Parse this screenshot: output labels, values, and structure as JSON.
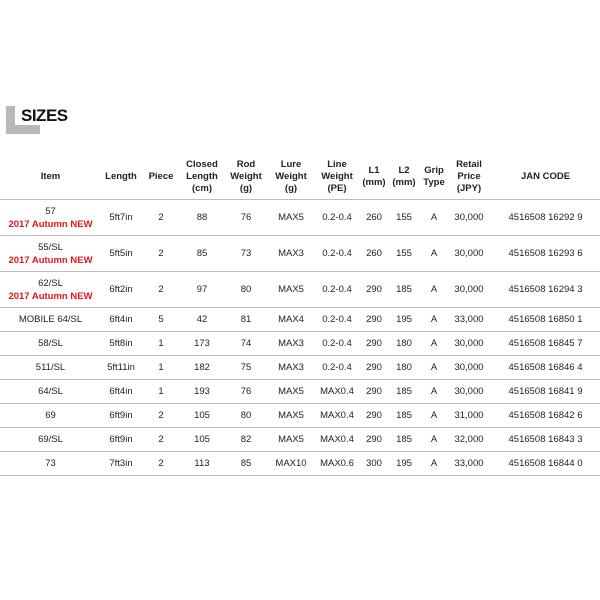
{
  "section_title": "SIZES",
  "colors": {
    "accent_new": "#e2171d",
    "heading_mark": "#b8b8b8",
    "rule": "#bdbdbd"
  },
  "columns": [
    [
      "Item"
    ],
    [
      "Length"
    ],
    [
      "Piece"
    ],
    [
      "Closed",
      "Length",
      "(cm)"
    ],
    [
      "Rod",
      "Weight",
      "(g)"
    ],
    [
      "Lure",
      "Weight",
      "(g)"
    ],
    [
      "Line",
      "Weight",
      "(PE)"
    ],
    [
      "L1",
      "(mm)"
    ],
    [
      "L2",
      "(mm)"
    ],
    [
      "Grip",
      "Type"
    ],
    [
      "Retail",
      "Price",
      "(JPY)"
    ],
    [
      "JAN CODE"
    ]
  ],
  "rows": [
    {
      "item": "57",
      "badge": "2017 Autumn NEW",
      "length": "5ft7in",
      "piece": "2",
      "closed": "88",
      "weight": "76",
      "lure": "MAX5",
      "line": "0.2-0.4",
      "l1": "260",
      "l2": "155",
      "grip": "A",
      "price": "30,000",
      "jan": "4516508 16292 9"
    },
    {
      "item": "55/SL",
      "badge": "2017 Autumn NEW",
      "length": "5ft5in",
      "piece": "2",
      "closed": "85",
      "weight": "73",
      "lure": "MAX3",
      "line": "0.2-0.4",
      "l1": "260",
      "l2": "155",
      "grip": "A",
      "price": "30,000",
      "jan": "4516508 16293 6"
    },
    {
      "item": "62/SL",
      "badge": "2017 Autumn NEW",
      "length": "6ft2in",
      "piece": "2",
      "closed": "97",
      "weight": "80",
      "lure": "MAX5",
      "line": "0.2-0.4",
      "l1": "290",
      "l2": "185",
      "grip": "A",
      "price": "30,000",
      "jan": "4516508 16294 3"
    },
    {
      "item": "MOBILE 64/SL",
      "length": "6ft4in",
      "piece": "5",
      "closed": "42",
      "weight": "81",
      "lure": "MAX4",
      "line": "0.2-0.4",
      "l1": "290",
      "l2": "195",
      "grip": "A",
      "price": "33,000",
      "jan": "4516508 16850 1"
    },
    {
      "item": "58/SL",
      "length": "5ft8in",
      "piece": "1",
      "closed": "173",
      "weight": "74",
      "lure": "MAX3",
      "line": "0.2-0.4",
      "l1": "290",
      "l2": "180",
      "grip": "A",
      "price": "30,000",
      "jan": "4516508 16845 7"
    },
    {
      "item": "511/SL",
      "length": "5ft11in",
      "piece": "1",
      "closed": "182",
      "weight": "75",
      "lure": "MAX3",
      "line": "0.2-0.4",
      "l1": "290",
      "l2": "180",
      "grip": "A",
      "price": "30,000",
      "jan": "4516508 16846 4"
    },
    {
      "item": "64/SL",
      "length": "6ft4in",
      "piece": "1",
      "closed": "193",
      "weight": "76",
      "lure": "MAX5",
      "line": "MAX0.4",
      "l1": "290",
      "l2": "185",
      "grip": "A",
      "price": "30,000",
      "jan": "4516508 16841 9"
    },
    {
      "item": "69",
      "length": "6ft9in",
      "piece": "2",
      "closed": "105",
      "weight": "80",
      "lure": "MAX5",
      "line": "MAX0.4",
      "l1": "290",
      "l2": "185",
      "grip": "A",
      "price": "31,000",
      "jan": "4516508 16842 6"
    },
    {
      "item": "69/SL",
      "length": "6ft9in",
      "piece": "2",
      "closed": "105",
      "weight": "82",
      "lure": "MAX5",
      "line": "MAX0.4",
      "l1": "290",
      "l2": "185",
      "grip": "A",
      "price": "32,000",
      "jan": "4516508 16843 3"
    },
    {
      "item": "73",
      "length": "7ft3in",
      "piece": "2",
      "closed": "113",
      "weight": "85",
      "lure": "MAX10",
      "line": "MAX0.6",
      "l1": "300",
      "l2": "195",
      "grip": "A",
      "price": "33,000",
      "jan": "4516508 16844 0"
    }
  ]
}
